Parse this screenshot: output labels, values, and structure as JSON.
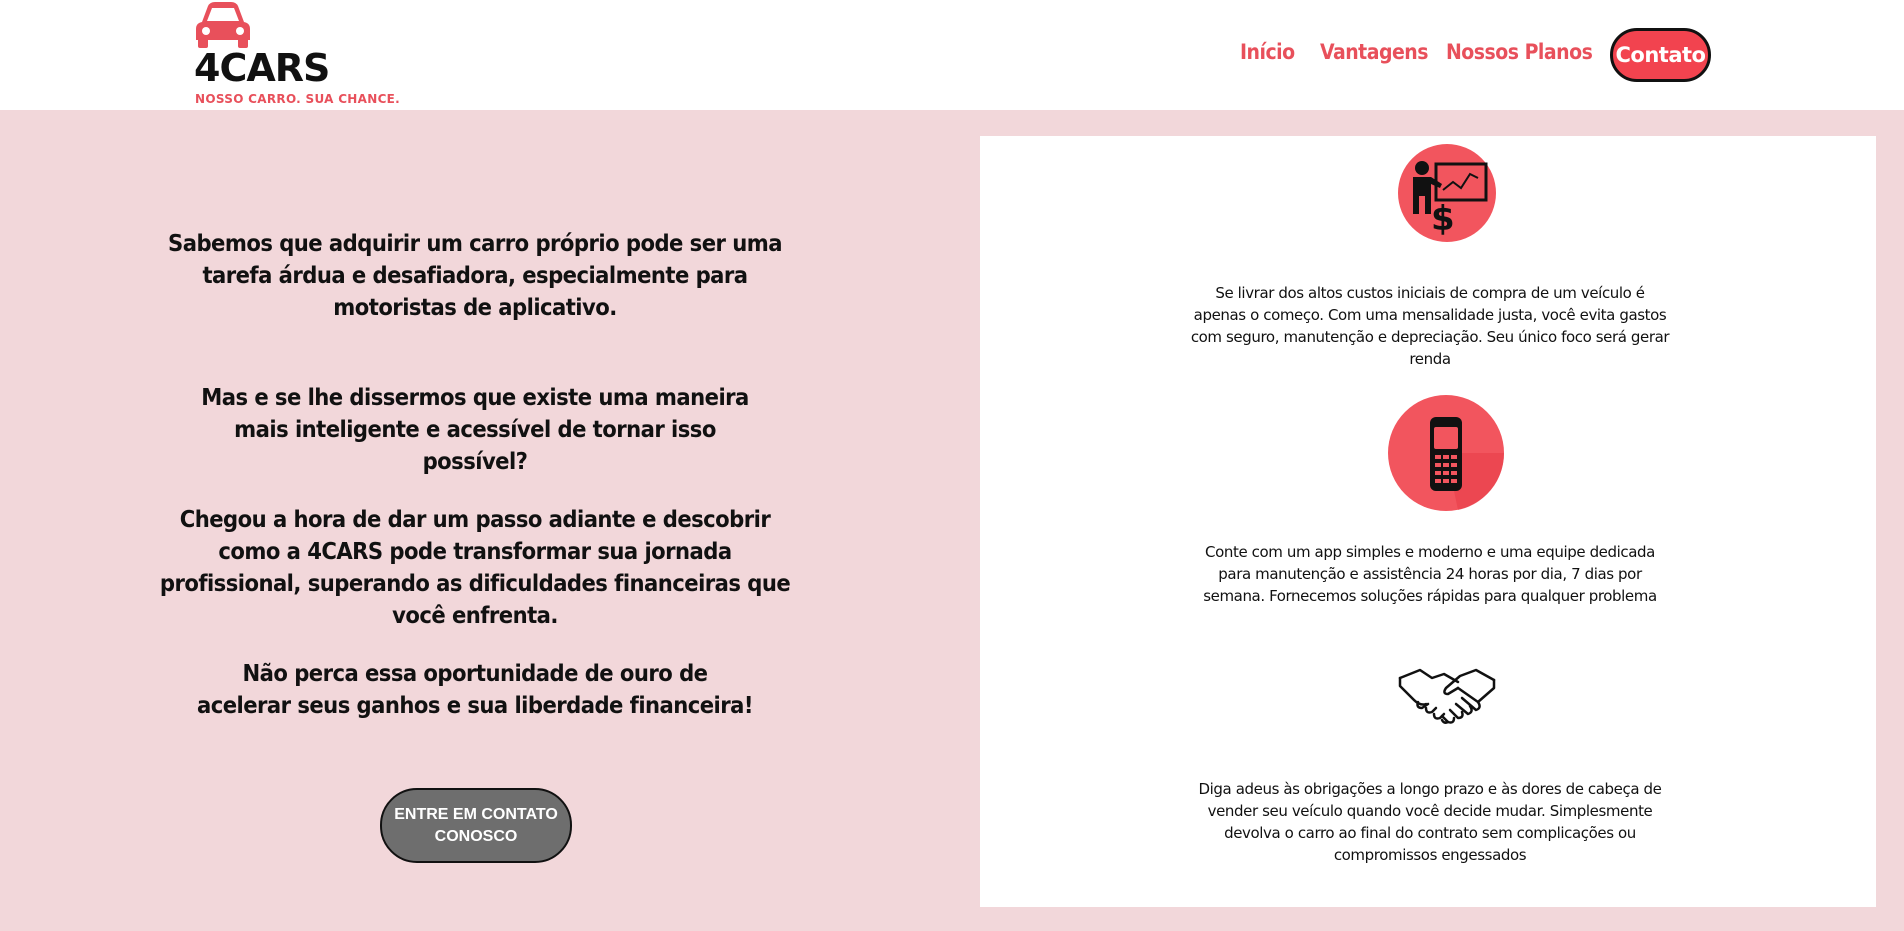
{
  "brand": {
    "name": "4CARS",
    "tagline": "NOSSO CARRO. SUA CHANCE.",
    "accent_color": "#e8505b",
    "logo_icon": "car-icon"
  },
  "nav": {
    "items": [
      {
        "label": "Início"
      },
      {
        "label": "Vantagens"
      },
      {
        "label": "Nossos Planos"
      }
    ],
    "contact_label": "Contato"
  },
  "intro": {
    "paragraphs": [
      "Sabemos que adquirir um carro próprio pode ser uma tarefa árdua e desafiadora, especialmente para motoristas de aplicativo.",
      "Mas e se lhe dissermos que existe uma maneira mais inteligente e acessível de tornar isso possível?",
      "Chegou a hora de dar um passo adiante e descobrir como a 4CARS pode transformar sua jornada profissional, superando as dificuldades financeiras que você enfrenta.",
      "Não perca essa oportunidade de ouro de acelerar seus ganhos e sua liberdade financeira!"
    ],
    "cta_label": "ENTRE EM CONTATO CONOSCO"
  },
  "features": [
    {
      "icon": "presentation-money-icon",
      "text": "Se livrar dos altos custos iniciais de compra de um veículo é apenas o começo. Com uma mensalidade justa, você evita gastos com seguro, manutenção e depreciação. Seu único foco será gerar renda"
    },
    {
      "icon": "mobile-phone-icon",
      "text": "Conte com um app simples e moderno e uma equipe dedicada para manutenção e assistência 24 horas por dia, 7 dias por semana. Fornecemos soluções rápidas para qualquer problema"
    },
    {
      "icon": "handshake-icon",
      "text": "Diga adeus às obrigações a longo prazo e às dores de cabeça de vender seu veículo quando você decide mudar. Simplesmente devolva o carro ao final do contrato sem complicações ou compromissos engessados"
    }
  ]
}
